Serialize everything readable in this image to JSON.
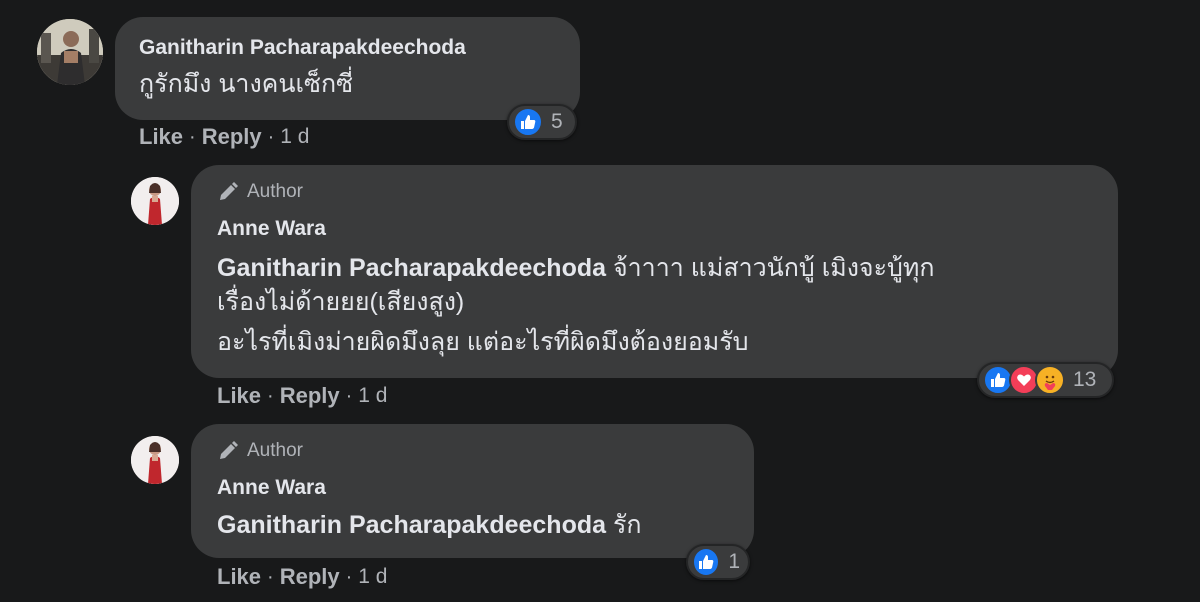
{
  "colors": {
    "background": "#18191a",
    "bubble": "#3a3b3c",
    "text": "#e4e6eb",
    "secondary_text": "#b0b3b8",
    "like_blue": "#1877f2",
    "love_red": "#f33e58",
    "care_yellow": "#f7b125"
  },
  "comments": [
    {
      "author_name": "Ganitharin Pacharapakdeechoda",
      "text": "กูรักมึง นางคนเซ็กซี่",
      "actions": {
        "like": "Like",
        "reply": "Reply",
        "time": "1 d"
      },
      "reaction_icons": [
        "like-icon"
      ],
      "reaction_count": "5"
    },
    {
      "badge": "Author",
      "author_name": "Anne Wara",
      "mention": "Ganitharin Pacharapakdeechoda",
      "text_line1_rest": " จ้าาาา แม่สาวนักบู้ เมิงจะบู้ทุก",
      "text_line2": "เรื่องไม่ด้ายยย(เสียงสูง)",
      "text_line3": "อะไรที่เมิงม่ายผิดมึงลุย แต่อะไรที่ผิดมึงต้องยอมรับ",
      "actions": {
        "like": "Like",
        "reply": "Reply",
        "time": "1 d"
      },
      "reaction_icons": [
        "like-icon",
        "love-icon",
        "care-icon"
      ],
      "reaction_count": "13"
    },
    {
      "badge": "Author",
      "author_name": "Anne Wara",
      "mention": "Ganitharin Pacharapakdeechoda",
      "text_rest": " รัก",
      "actions": {
        "like": "Like",
        "reply": "Reply",
        "time": "1 d"
      },
      "reaction_icons": [
        "like-icon"
      ],
      "reaction_count": "1"
    }
  ]
}
